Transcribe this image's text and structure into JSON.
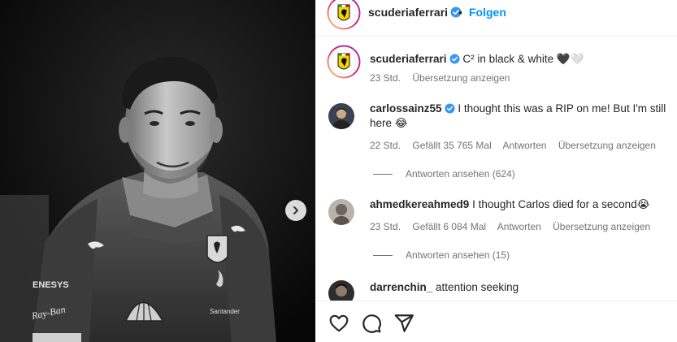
{
  "post": {
    "author": "scuderiaferrari",
    "follow_label": "Folgen",
    "separator": "•"
  },
  "caption": {
    "username": "scuderiaferrari",
    "text": "C² in black & white 🖤🤍",
    "time": "23 Std.",
    "translate": "Übersetzung anzeigen"
  },
  "comments": [
    {
      "username": "carlossainz55",
      "verified": true,
      "text": "I thought this was a RIP on me! But I'm still here 😂",
      "time": "22 Std.",
      "likes": "Gefällt 35 765 Mal",
      "reply": "Antworten",
      "translate": "Übersetzung anzeigen",
      "view_replies": "Antworten ansehen (624)"
    },
    {
      "username": "ahmedkereahmed9",
      "verified": false,
      "text": "I thought Carlos died for a second😭",
      "time": "23 Std.",
      "likes": "Gefällt 6 084 Mal",
      "reply": "Antworten",
      "translate": "Übersetzung anzeigen",
      "view_replies": "Antworten ansehen (15)"
    },
    {
      "username": "darrenchin_",
      "verified": false,
      "text": "attention seeking"
    }
  ],
  "photo": {
    "suit_texts": [
      "ENESYS",
      "Ray-Ban",
      "Shell",
      "Santander"
    ]
  },
  "icons": {
    "like": "heart-icon",
    "comment": "comment-icon",
    "share": "share-icon",
    "next": "chevron-right-icon",
    "verified": "verified-badge-icon"
  },
  "colors": {
    "link_blue": "#0095f6",
    "verified_blue": "#3897f0",
    "text": "#262626",
    "secondary": "#737373"
  }
}
